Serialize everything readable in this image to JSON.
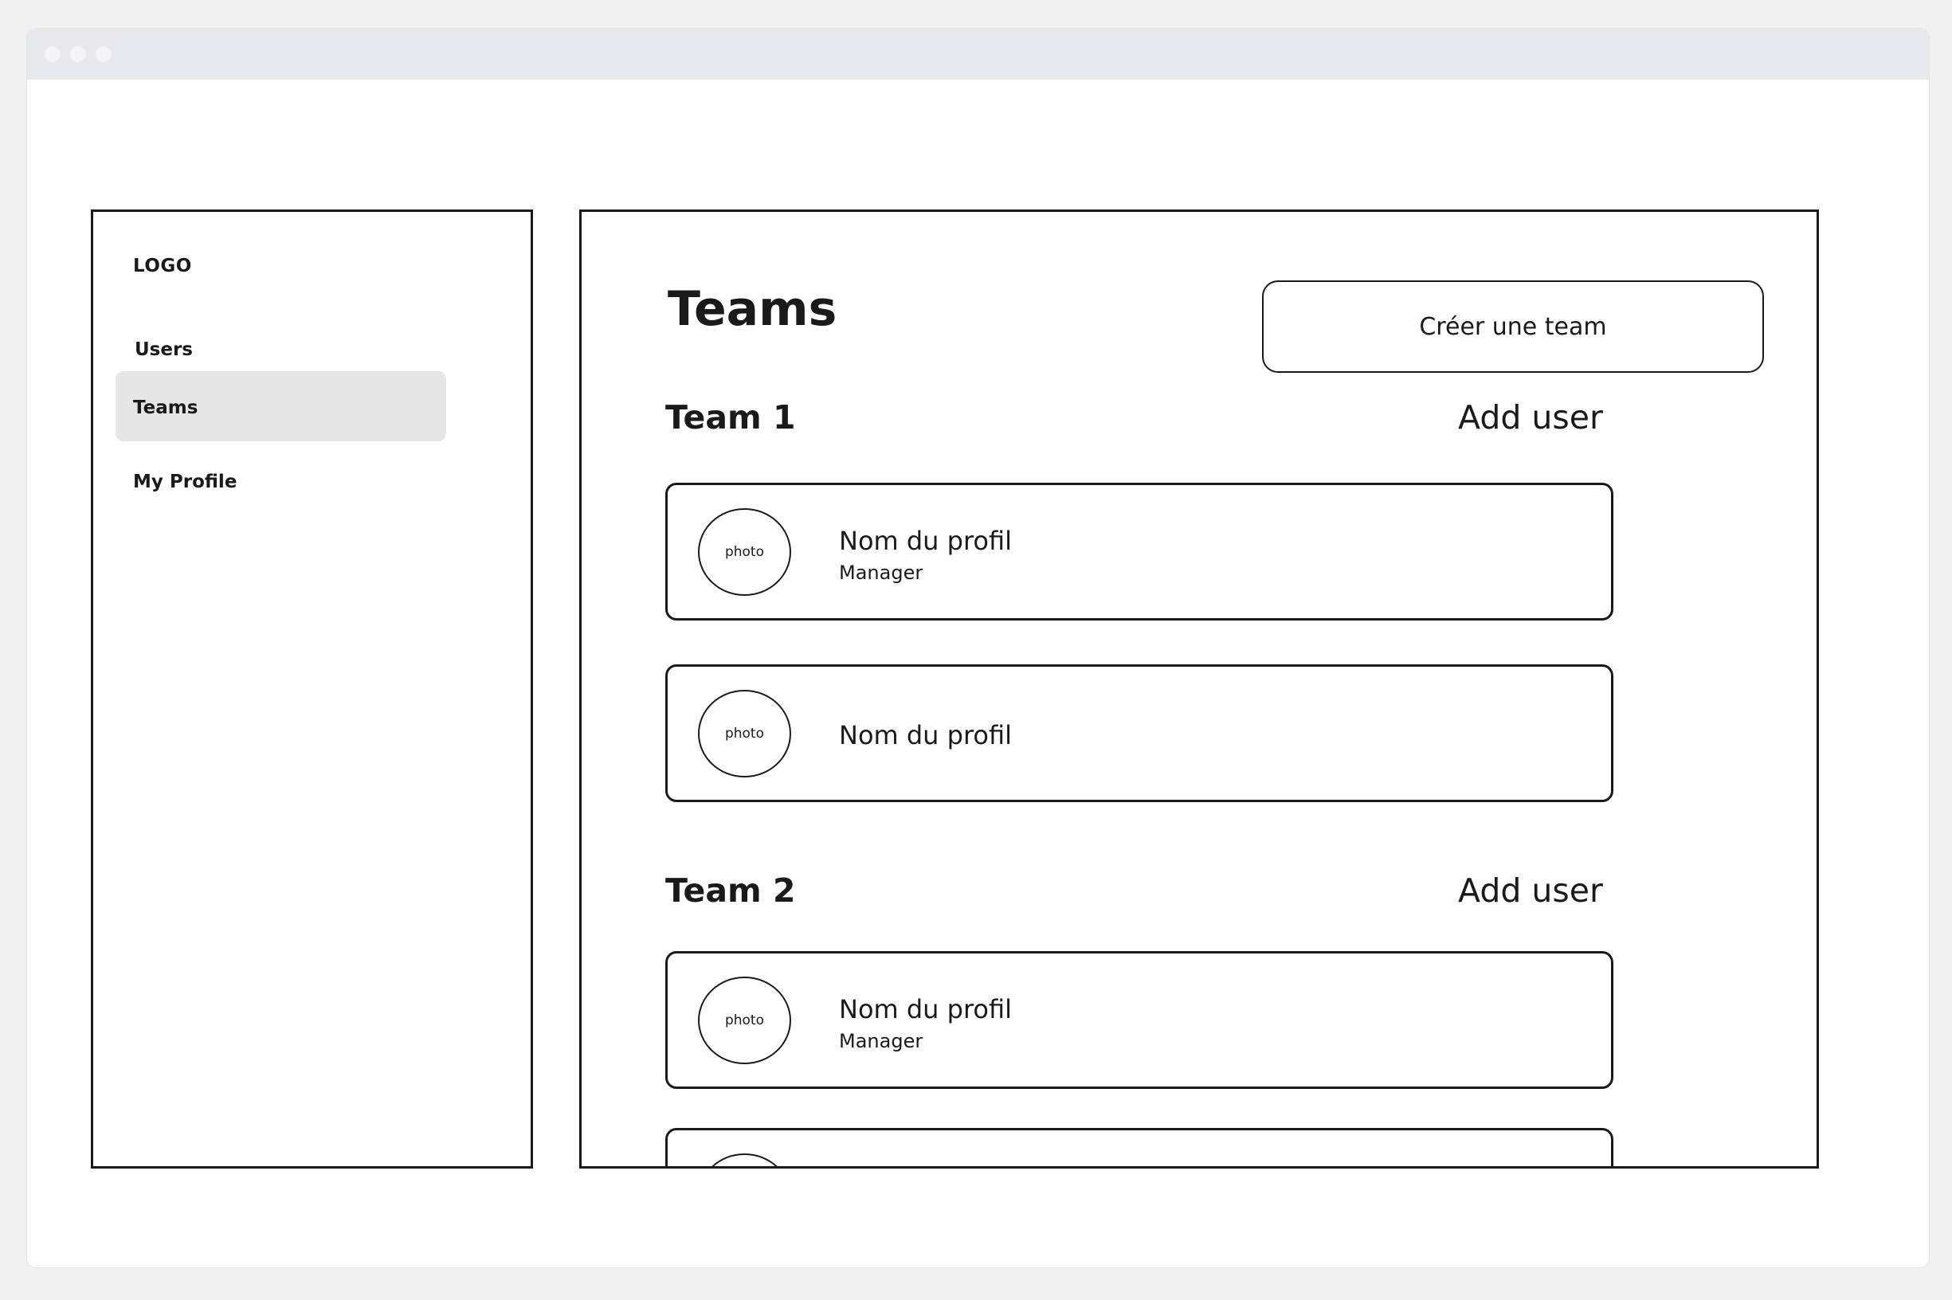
{
  "sidebar": {
    "logo": "LOGO",
    "items": [
      {
        "label": "Users"
      },
      {
        "label": "Teams",
        "active": true
      },
      {
        "label": "My Profile"
      }
    ],
    "active_color": "#e6e6e6"
  },
  "main": {
    "title": "Teams",
    "create_button": "Créer une team",
    "teams": [
      {
        "name": "Team 1",
        "add_user_label": "Add user",
        "members": [
          {
            "avatar": "photo",
            "name": "Nom du profil",
            "role": "Manager"
          },
          {
            "avatar": "photo",
            "name": "Nom du profil"
          }
        ]
      },
      {
        "name": "Team 2",
        "add_user_label": "Add user",
        "members": [
          {
            "avatar": "photo",
            "name": "Nom du profil",
            "role": "Manager"
          },
          {
            "avatar": "",
            "name": ""
          }
        ]
      }
    ]
  }
}
